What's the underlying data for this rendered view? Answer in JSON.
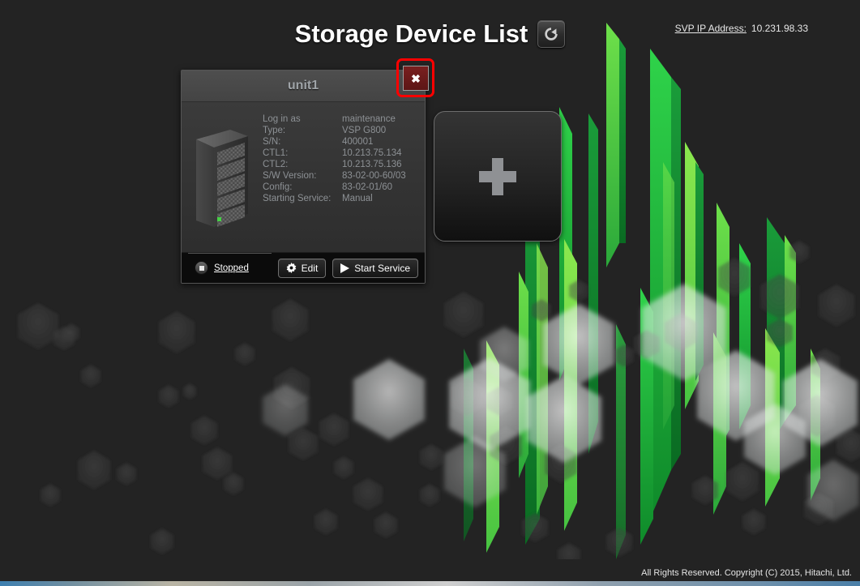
{
  "header": {
    "title": "Storage Device List",
    "refresh_icon": "refresh-icon",
    "svp_ip_label": "SVP IP Address:",
    "svp_ip_value": "10.231.98.33"
  },
  "device_card": {
    "title": "unit1",
    "device_icon": "storage-rack-icon",
    "properties": [
      {
        "label": "Log in as",
        "value": "maintenance"
      },
      {
        "label": "Type:",
        "value": "VSP G800"
      },
      {
        "label": "S/N:",
        "value": "400001"
      },
      {
        "label": "CTL1:",
        "value": "10.213.75.134"
      },
      {
        "label": "CTL2:",
        "value": "10.213.75.136"
      },
      {
        "label": "S/W Version:",
        "value": "83-02-00-60/03"
      },
      {
        "label": "Config:",
        "value": "83-02-01/60"
      },
      {
        "label": "Starting Service:",
        "value": "Manual"
      }
    ],
    "status": {
      "icon": "stop-icon",
      "text": "Stopped"
    },
    "buttons": [
      {
        "icon": "gear-icon",
        "label": "Edit"
      },
      {
        "icon": "play-icon",
        "label": "Start Service"
      }
    ],
    "close_label": "✖"
  },
  "add_tile": {
    "icon": "plus-icon"
  },
  "footer": {
    "copyright": "All Rights Reserved. Copyright (C) 2015, Hitachi, Ltd."
  },
  "colors": {
    "background": "#232323",
    "accent_green": "#3ec93e",
    "highlight_red": "#ff0000",
    "close_button": "#6d1a1a",
    "card_body": "#333333",
    "card_header": "#484848",
    "text_muted": "#8d9195"
  }
}
